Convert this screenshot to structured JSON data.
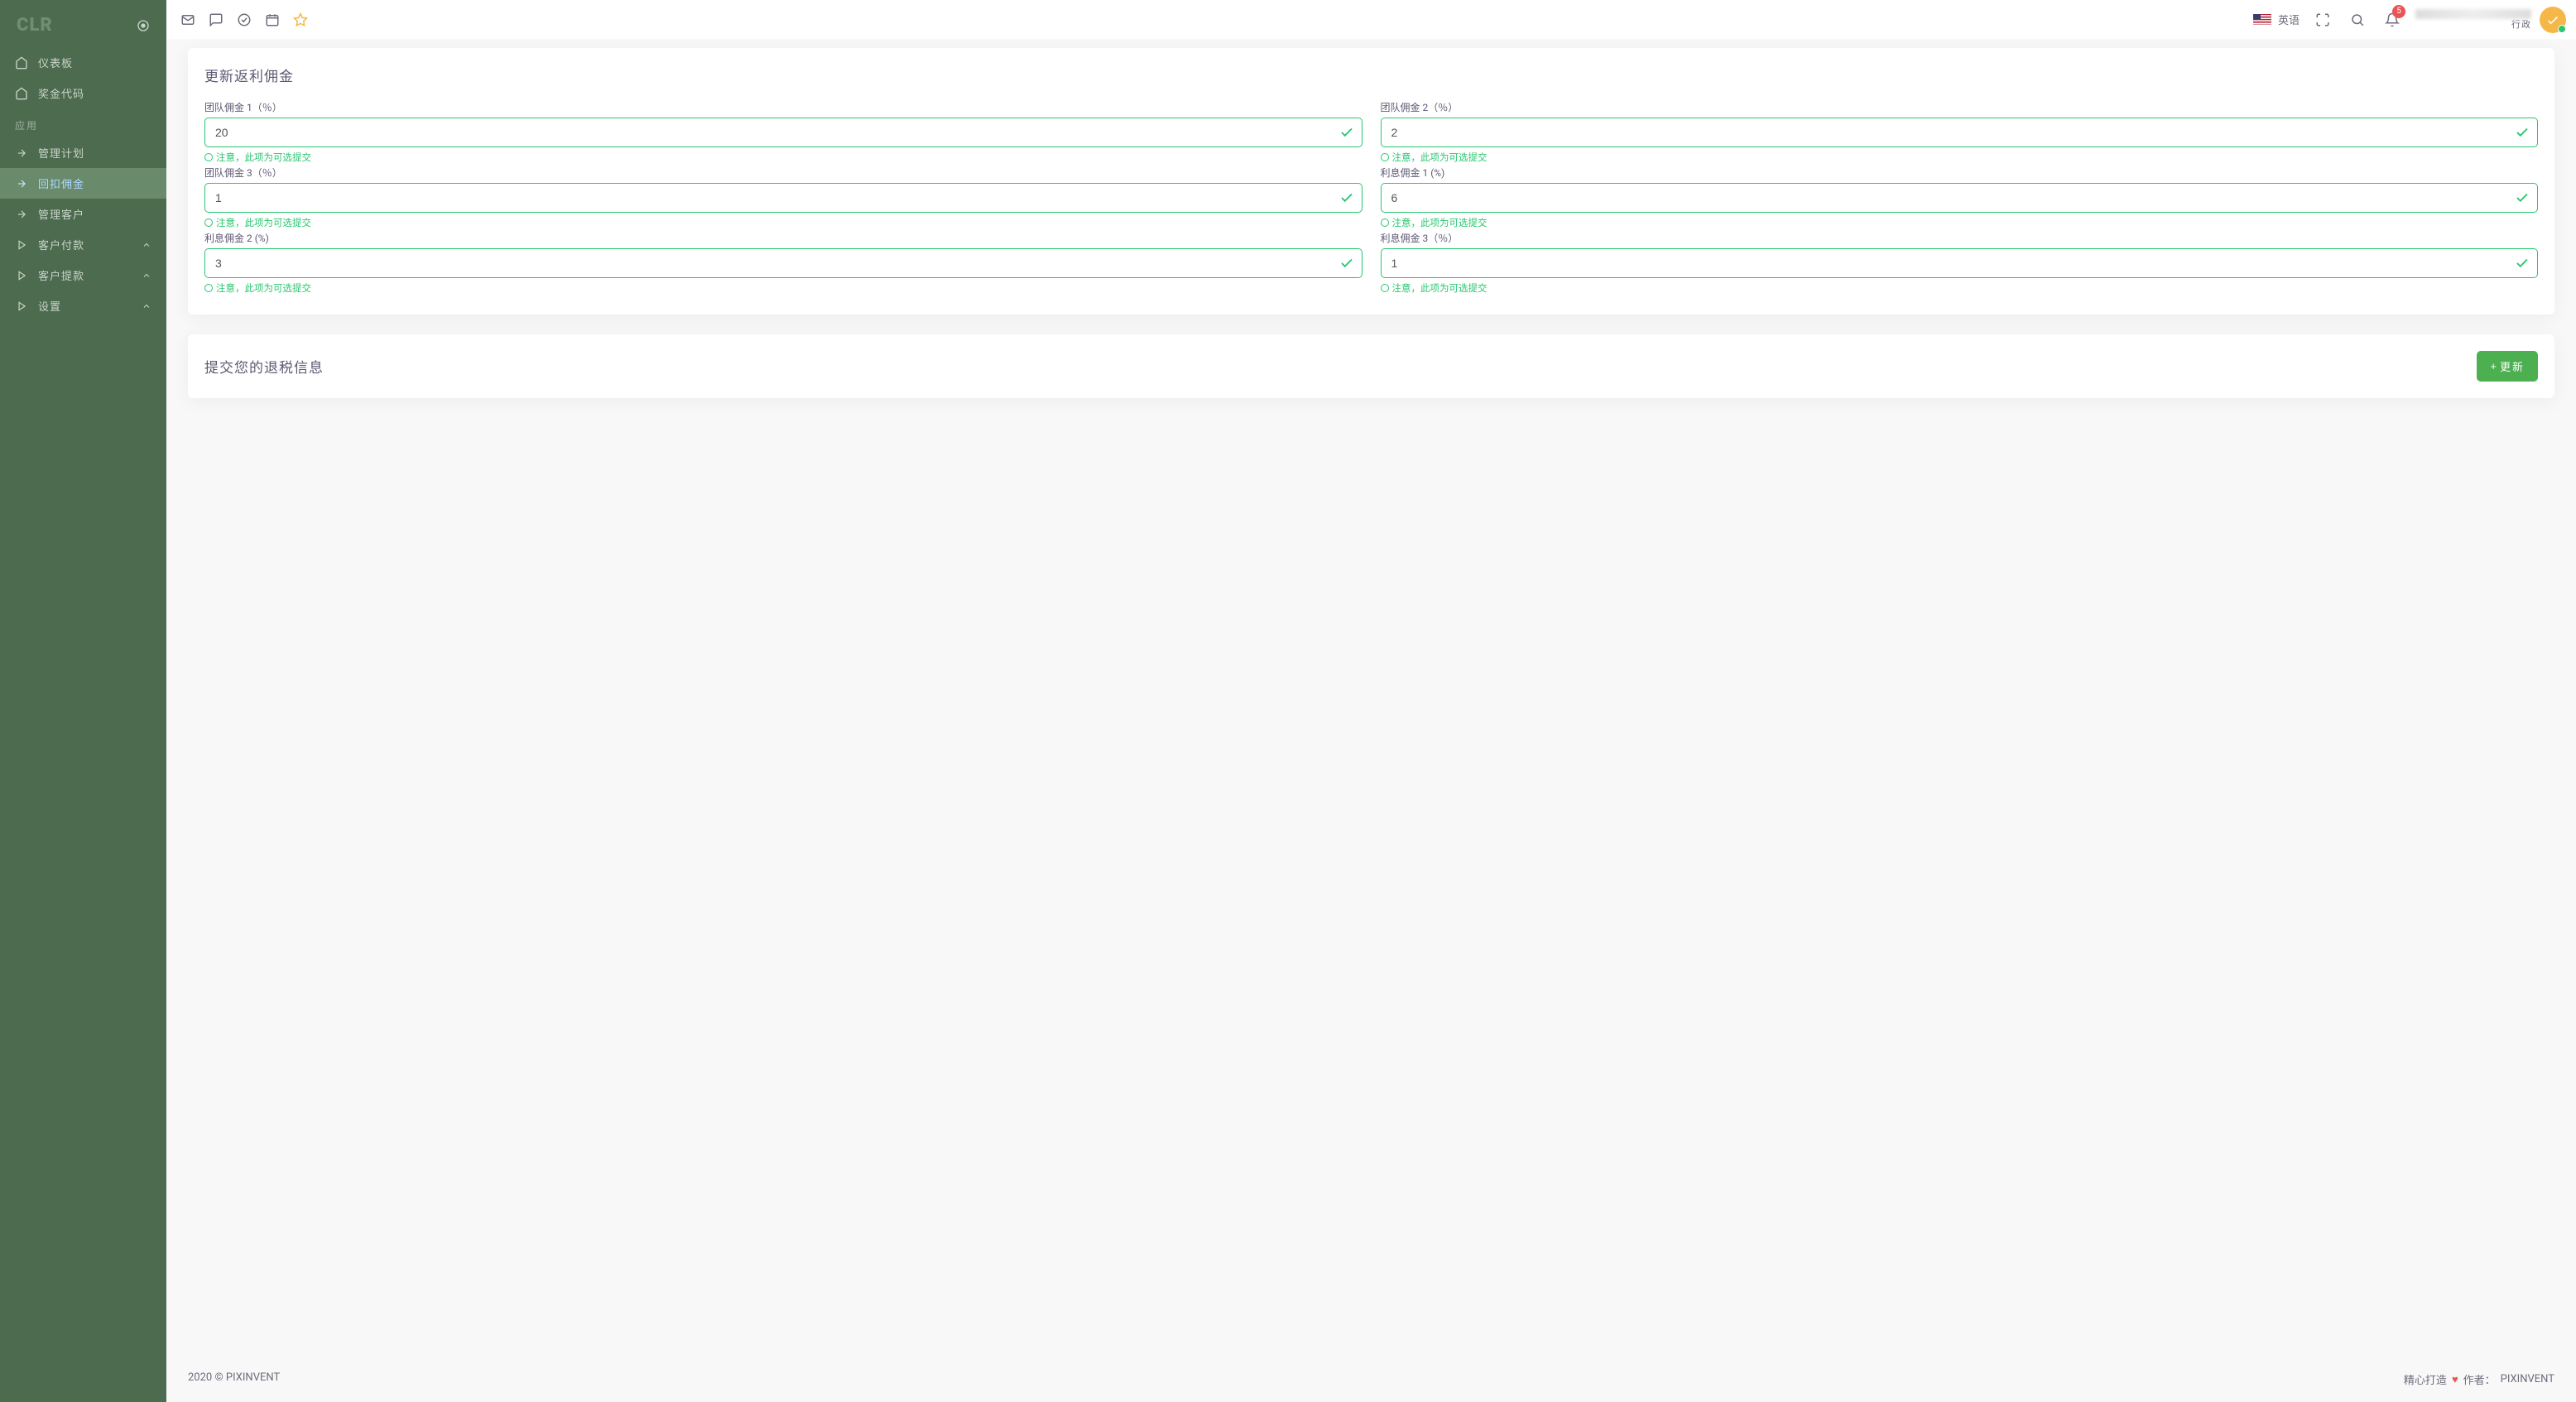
{
  "brand": "CLR",
  "sidebar": {
    "main": [
      {
        "label": "仪表板"
      },
      {
        "label": "奖金代码"
      }
    ],
    "section_header": "应用",
    "apps": [
      {
        "label": "管理计划"
      },
      {
        "label": "回扣佣金"
      },
      {
        "label": "管理客户"
      },
      {
        "label": "客户付款"
      },
      {
        "label": "客户提款"
      },
      {
        "label": "设置"
      }
    ]
  },
  "topbar": {
    "language": "英语",
    "notif_count": "5",
    "user_role": "行政"
  },
  "card1": {
    "title": "更新返利佣金",
    "hint": "注意，此项为可选提交",
    "fields": {
      "team1": {
        "label": "团队佣金 1（％）",
        "value": "20"
      },
      "team2": {
        "label": "团队佣金 2（％）",
        "value": "2"
      },
      "team3": {
        "label": "团队佣金 3（％）",
        "value": "1"
      },
      "int1": {
        "label": "利息佣金 1 (%)",
        "value": "6"
      },
      "int2": {
        "label": "利息佣金 2 (%)",
        "value": "3"
      },
      "int3": {
        "label": "利息佣金 3（％）",
        "value": "1"
      }
    }
  },
  "card2": {
    "title": "提交您的退税信息",
    "button": "更新"
  },
  "footer": {
    "left": "2020 © PIXINVENT",
    "right_pre": "精心打造",
    "right_mid": "作者：",
    "right_author": "PIXINVENT"
  }
}
